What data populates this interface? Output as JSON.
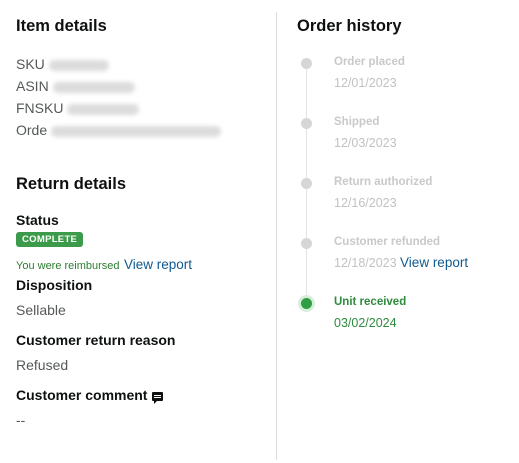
{
  "item_details": {
    "title": "Item details",
    "fields": [
      {
        "label": "SKU"
      },
      {
        "label": "ASIN"
      },
      {
        "label": "FNSKU"
      },
      {
        "label": "Orde"
      }
    ]
  },
  "return_details": {
    "title": "Return details",
    "status_label": "Status",
    "status_badge": "COMPLETE",
    "reimbursed_text": "You were reimbursed",
    "view_report": "View report",
    "disposition_label": "Disposition",
    "disposition_value": "Sellable",
    "reason_label": "Customer return reason",
    "reason_value": "Refused",
    "comment_label": "Customer comment",
    "comment_value": "--"
  },
  "order_history": {
    "title": "Order history",
    "steps": [
      {
        "name": "Order placed",
        "date": "12/01/2023"
      },
      {
        "name": "Shipped",
        "date": "12/03/2023"
      },
      {
        "name": "Return authorized",
        "date": "12/16/2023"
      },
      {
        "name": "Customer refunded",
        "date": "12/18/2023",
        "link": "View report"
      },
      {
        "name": "Unit received",
        "date": "03/02/2024",
        "active": true
      }
    ]
  },
  "colors": {
    "success": "#3c9b4a",
    "link": "#0f5a8f",
    "muted": "#c9c9c9"
  }
}
